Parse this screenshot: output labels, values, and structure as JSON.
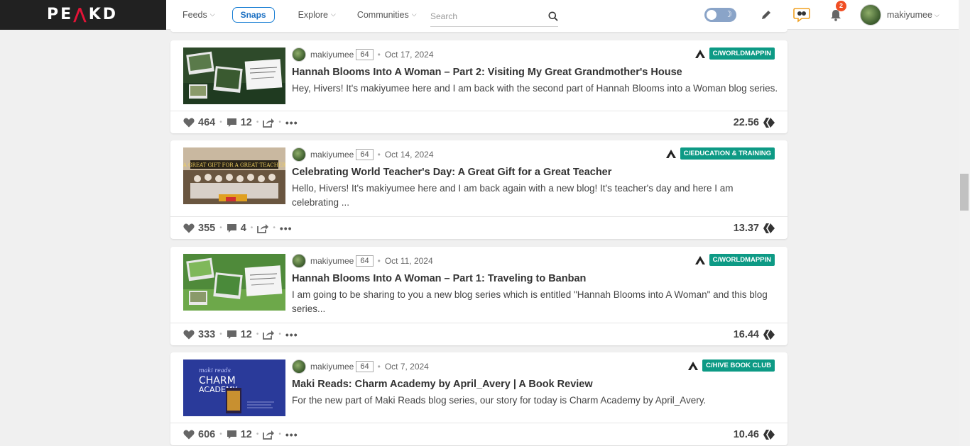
{
  "brand": {
    "logo": "PEAKD"
  },
  "nav": {
    "feeds": "Feeds",
    "snaps": "Snaps",
    "explore": "Explore",
    "communities": "Communities",
    "search_placeholder": "Search"
  },
  "notifications": {
    "count": "2"
  },
  "user": {
    "name": "makiyumee"
  },
  "posts": [
    {
      "author": "makiyumee",
      "reputation": "64",
      "date": "Oct 17, 2024",
      "community": "C/WORLDMAPPIN",
      "title": "Hannah Blooms Into A Woman – Part 2: Visiting My Great Grandmother's House",
      "excerpt": "Hey, Hivers! It's makiyumee here and I am back with the second part of Hannah Blooms into a Woman blog series.",
      "votes": "464",
      "comments": "12",
      "payout": "22.56",
      "thumb_color": "#2e4a2a"
    },
    {
      "author": "makiyumee",
      "reputation": "64",
      "date": "Oct 14, 2024",
      "community": "C/EDUCATION & TRAINING",
      "title": "Celebrating World Teacher's Day: A Great Gift for a Great Teacher",
      "excerpt": "Hello, Hivers! It's makiyumee here and I am back again with a new blog! It's teacher's day and here I am celebrating ...",
      "votes": "355",
      "comments": "4",
      "payout": "13.37",
      "thumb_color": "#7a5a3a"
    },
    {
      "author": "makiyumee",
      "reputation": "64",
      "date": "Oct 11, 2024",
      "community": "C/WORLDMAPPIN",
      "title": "Hannah Blooms Into A Woman – Part 1: Traveling to Banban",
      "excerpt": "I am going to be sharing to you a new blog series which is entitled \"Hannah Blooms into A Woman\" and this blog series...",
      "votes": "333",
      "comments": "12",
      "payout": "16.44",
      "thumb_color": "#4f8a3a"
    },
    {
      "author": "makiyumee",
      "reputation": "64",
      "date": "Oct 7, 2024",
      "community": "C/HIVE BOOK CLUB",
      "title": "Maki Reads: Charm Academy by April_Avery | A Book Review",
      "excerpt": "For the new part of Maki Reads blog series, our story for today is Charm Academy by April_Avery.",
      "votes": "606",
      "comments": "12",
      "payout": "10.46",
      "thumb_color": "#2a3a9a"
    }
  ],
  "thumb_texts": {
    "post4_line1": "maki reads",
    "post4_line2": "CHARM",
    "post4_line3": "ACADEMY",
    "post2_banner": "A GREAT GIFT FOR A GREAT TEACHER"
  }
}
